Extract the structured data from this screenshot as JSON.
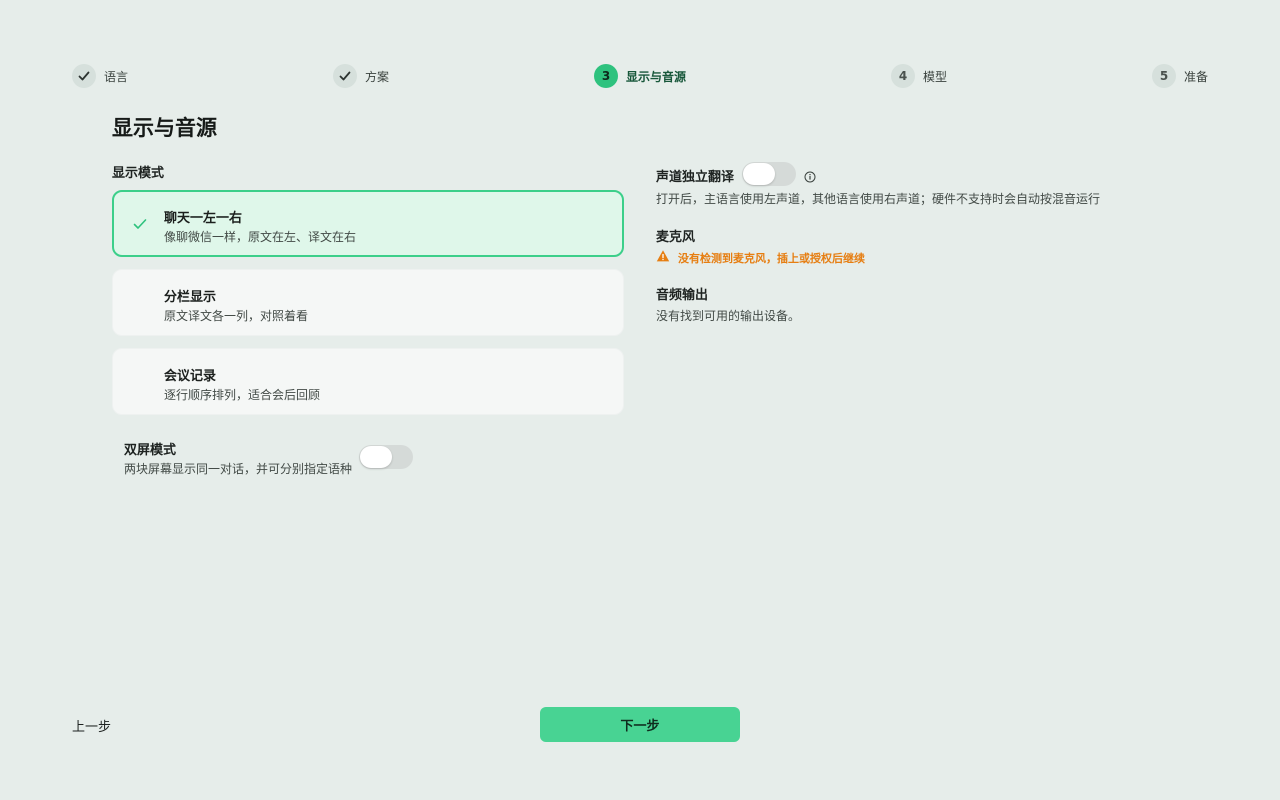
{
  "stepper": {
    "steps": [
      {
        "number": "1",
        "label": "语言",
        "state": "done"
      },
      {
        "number": "2",
        "label": "方案",
        "state": "done"
      },
      {
        "number": "3",
        "label": "显示与音源",
        "state": "active"
      },
      {
        "number": "4",
        "label": "模型",
        "state": "todo"
      },
      {
        "number": "5",
        "label": "准备",
        "state": "todo"
      }
    ]
  },
  "page": {
    "title": "显示与音源"
  },
  "display_mode": {
    "label": "显示模式",
    "options": [
      {
        "title": "聊天一左一右",
        "desc": "像聊微信一样，原文在左、译文在右",
        "selected": true
      },
      {
        "title": "分栏显示",
        "desc": "原文译文各一列，对照着看",
        "selected": false
      },
      {
        "title": "会议记录",
        "desc": "逐行顺序排列，适合会后回顾",
        "selected": false
      }
    ]
  },
  "dual_screen": {
    "title": "双屏模式",
    "desc": "两块屏幕显示同一对话，并可分别指定语种",
    "enabled": false
  },
  "channel_translate": {
    "title": "声道独立翻译",
    "desc": "打开后，主语言使用左声道，其他语言使用右声道；硬件不支持时会自动按混音运行",
    "enabled": false
  },
  "microphone": {
    "title": "麦克风",
    "warning": "没有检测到麦克风，插上或授权后继续"
  },
  "audio_output": {
    "title": "音频输出",
    "desc": "没有找到可用的输出设备。"
  },
  "footer": {
    "back_label": "上一步",
    "next_label": "下一步"
  },
  "colors": {
    "accent": "#2ec27e",
    "button": "#48d393",
    "selected_bg": "#dff7ea",
    "warning": "#e67e12",
    "background": "#e6edea"
  }
}
